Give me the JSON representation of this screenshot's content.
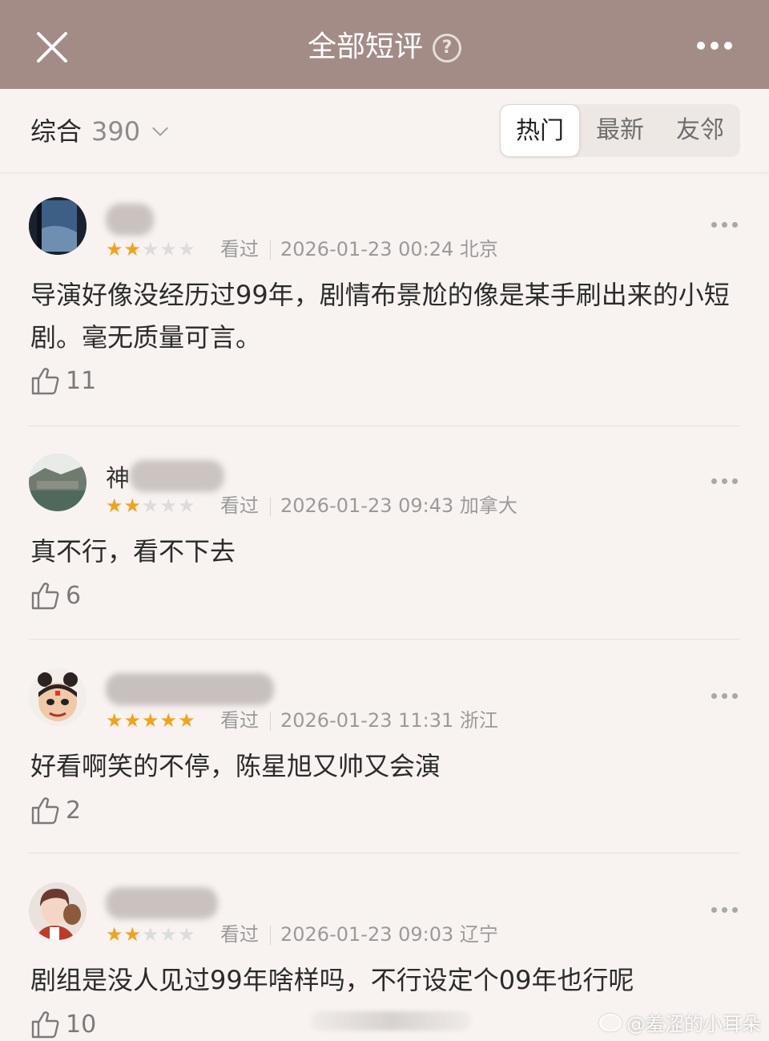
{
  "header": {
    "title": "全部短评",
    "help_glyph": "?",
    "close_icon": "close-icon",
    "more_icon": "more-horizontal-icon"
  },
  "filter": {
    "sort_label": "综合",
    "count": "390",
    "tabs": [
      {
        "label": "热门",
        "active": true
      },
      {
        "label": "最新",
        "active": false
      },
      {
        "label": "友邻",
        "active": false
      }
    ]
  },
  "reviews": [
    {
      "name_glyph": "",
      "rating": 2,
      "status": "看过",
      "datetime": "2026-01-23 00:24",
      "location": "北京",
      "text": "导演好像没经历过99年，剧情布景尬的像是某手刷出来的小短剧。毫无质量可言。",
      "likes": "11"
    },
    {
      "name_glyph": "神",
      "rating": 2,
      "status": "看过",
      "datetime": "2026-01-23 09:43",
      "location": "加拿大",
      "text": "真不行，看不下去",
      "likes": "6"
    },
    {
      "name_glyph": "",
      "rating": 5,
      "status": "看过",
      "datetime": "2026-01-23 11:31",
      "location": "浙江",
      "text": "好看啊笑的不停，陈星旭又帅又会演",
      "likes": "2"
    },
    {
      "name_glyph": "",
      "rating": 2,
      "status": "看过",
      "datetime": "2026-01-23 09:03",
      "location": "辽宁",
      "text": "剧组是没人见过99年啥样吗，不行设定个09年也行呢",
      "likes": "10"
    }
  ],
  "colors": {
    "header_bg": "#a38c86",
    "star_on": "#f2a31c",
    "star_off": "#dcdcdc",
    "page_bg": "#f8f3f1"
  },
  "watermark": "@羞涩的小耳朵"
}
